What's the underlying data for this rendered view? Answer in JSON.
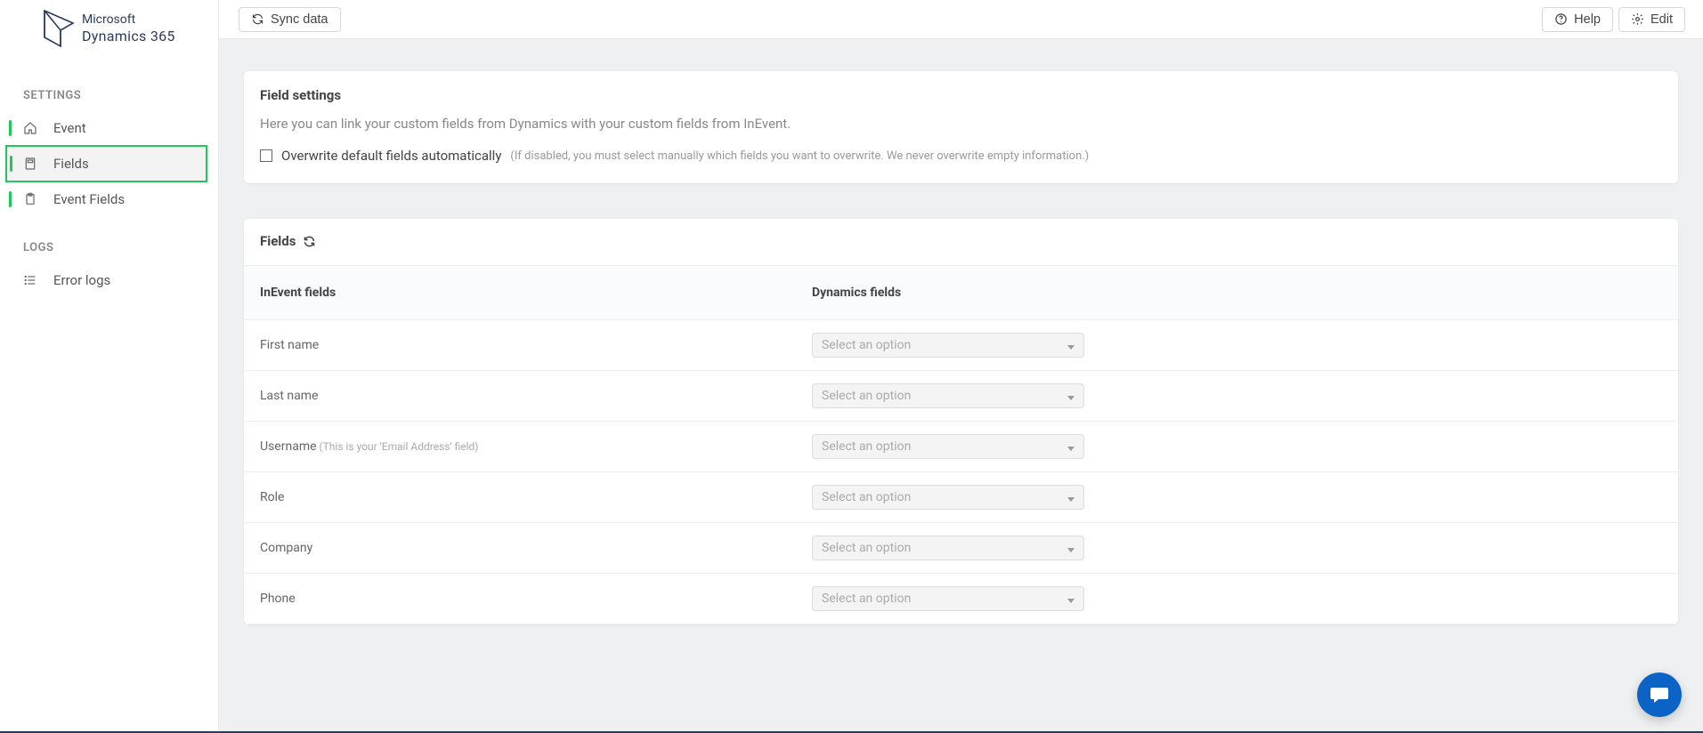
{
  "logo": {
    "line1": "Microsoft",
    "line2": "Dynamics 365"
  },
  "sidebar": {
    "section_settings": "SETTINGS",
    "section_logs": "LOGS",
    "items": [
      {
        "label": "Event"
      },
      {
        "label": "Fields"
      },
      {
        "label": "Event Fields"
      }
    ],
    "logs_items": [
      {
        "label": "Error logs"
      }
    ]
  },
  "topbar": {
    "sync": "Sync data",
    "help": "Help",
    "edit": "Edit"
  },
  "fieldSettings": {
    "title": "Field settings",
    "desc": "Here you can link your custom fields from Dynamics with your custom fields from InEvent.",
    "checkbox_label": "Overwrite default fields automatically",
    "checkbox_sub": "(If disabled, you must select manually which fields you want to overwrite. We never overwrite empty information.)"
  },
  "fieldsCard": {
    "title": "Fields",
    "col_a": "InEvent fields",
    "col_b": "Dynamics fields",
    "select_placeholder": "Select an option",
    "rows": [
      {
        "label": "First name",
        "sub": ""
      },
      {
        "label": "Last name",
        "sub": ""
      },
      {
        "label": "Username",
        "sub": "(This is your 'Email Address' field)"
      },
      {
        "label": "Role",
        "sub": ""
      },
      {
        "label": "Company",
        "sub": ""
      },
      {
        "label": "Phone",
        "sub": ""
      }
    ]
  }
}
